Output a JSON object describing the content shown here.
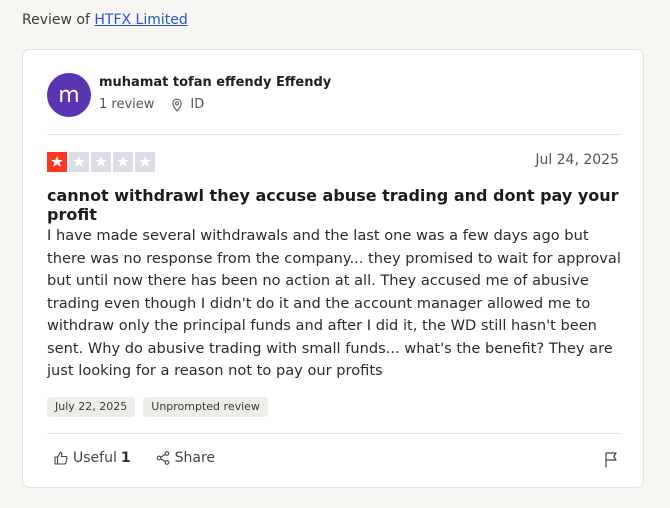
{
  "header": {
    "prefix": "Review of",
    "company_link": "HTFX Limited"
  },
  "reviewer": {
    "avatar_letter": "m",
    "avatar_color": "#5a35b3",
    "name": "muhamat tofan effendy Effendy",
    "review_count": "1 review",
    "country": "ID",
    "location_icon": "location-pin-icon"
  },
  "review": {
    "rating": 1,
    "max_rating": 5,
    "star_on_color": "#ff3722",
    "date": "Jul 24, 2025",
    "title": "cannot withdrawl they accuse abuse trading and dont pay your profit",
    "body": "I have made several withdrawals and the last one was a few days ago but there was no response from the company... they promised to wait for approval but until now there has been no action at all. They accused me of abusive trading even though I didn't do it and the account manager allowed me to withdraw only the principal funds and after I did it, the WD still hasn't been sent. Why do abusive trading with small funds... what's the benefit? They are just looking for a reason not to pay our profits",
    "tags": [
      "July 22, 2025",
      "Unprompted review"
    ]
  },
  "actions": {
    "useful_label": "Useful",
    "useful_count": "1",
    "share_label": "Share",
    "icons": [
      "thumbs-up-icon",
      "share-icon",
      "flag-icon"
    ]
  }
}
